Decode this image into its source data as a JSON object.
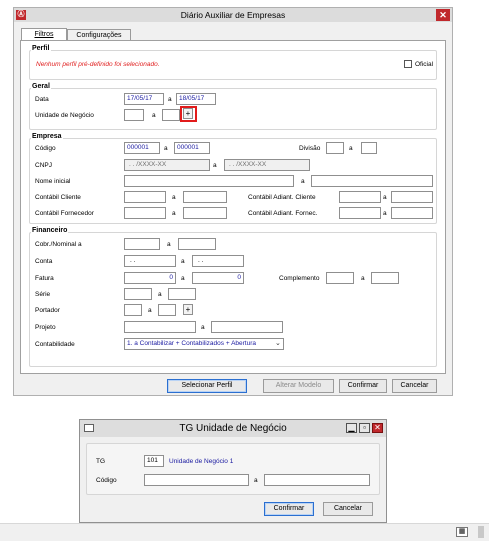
{
  "main_window": {
    "title": "Diário Auxiliar de Empresas",
    "tabs": [
      {
        "label": "Filtros",
        "active": true
      },
      {
        "label": "Configurações",
        "active": false
      }
    ],
    "perfil": {
      "heading": "Perfil",
      "message": "Nenhum perfil pré-definido foi selecionado.",
      "oficial_label": "Oficial",
      "oficial_checked": false
    },
    "geral": {
      "heading": "Geral",
      "data_label": "Data",
      "data_from": "17/05/17",
      "data_a": "a",
      "data_to": "18/05/17",
      "unidade_label": "Unidade de Negócio",
      "unidade_a": "a",
      "plus": "+"
    },
    "empresa": {
      "heading": "Empresa",
      "codigo_label": "Código",
      "codigo_from": "000001",
      "codigo_a": "a",
      "codigo_to": "000001",
      "divisao_label": "Divisão",
      "divisao_a": "a",
      "cnpj_label": "CNPJ",
      "cnpj_from": ". .  /XXXX-XX",
      "cnpj_a": "a",
      "cnpj_to": ". .  /XXXX-XX",
      "nome_label": "Nome inicial",
      "nome_a": "a",
      "contabil_cliente_label": "Contábil Cliente",
      "contabil_cliente_a": "a",
      "adiant_cliente_label": "Contábil Adiant. Cliente",
      "adiant_cliente_a": "a",
      "contabil_fornecedor_label": "Contábil Fornecedor",
      "contabil_fornecedor_a": "a",
      "adiant_fornec_label": "Contábil Adiant. Fornec.",
      "adiant_fornec_a": "a"
    },
    "financeiro": {
      "heading": "Financeiro",
      "cobr_label": "Cobr./Nominal a",
      "cobr_a": "a",
      "conta_label": "Conta",
      "conta_from": ". .",
      "conta_a": "a",
      "conta_to": ". .",
      "fatura_label": "Fatura",
      "fatura_from": "0",
      "fatura_a": "a",
      "fatura_to": "0",
      "complemento_label": "Complemento",
      "complemento_a": "a",
      "serie_label": "Série",
      "serie_a": "a",
      "portador_label": "Portador",
      "portador_a": "a",
      "plus": "+",
      "projeto_label": "Projeto",
      "projeto_a": "a",
      "contabilidade_label": "Contabilidade",
      "contabilidade_value": "1. a Contabilizar + Contabilizados + Abertura"
    },
    "buttons": {
      "selecionar_perfil": "Selecionar Perfil",
      "alterar_modelo": "Alterar Modelo",
      "confirmar": "Confirmar",
      "cancelar": "Cancelar"
    }
  },
  "dialog": {
    "title": "TG Unidade de Negócio",
    "tg_label": "TG",
    "tg_code": "101",
    "tg_name": "Unidade de Negócio 1",
    "codigo_label": "Código",
    "codigo_a": "a",
    "confirmar": "Confirmar",
    "cancelar": "Cancelar"
  },
  "colors": {
    "accent_red": "#c0282c",
    "link_blue": "#1a1aa0",
    "default_border": "#2b6fd0"
  }
}
